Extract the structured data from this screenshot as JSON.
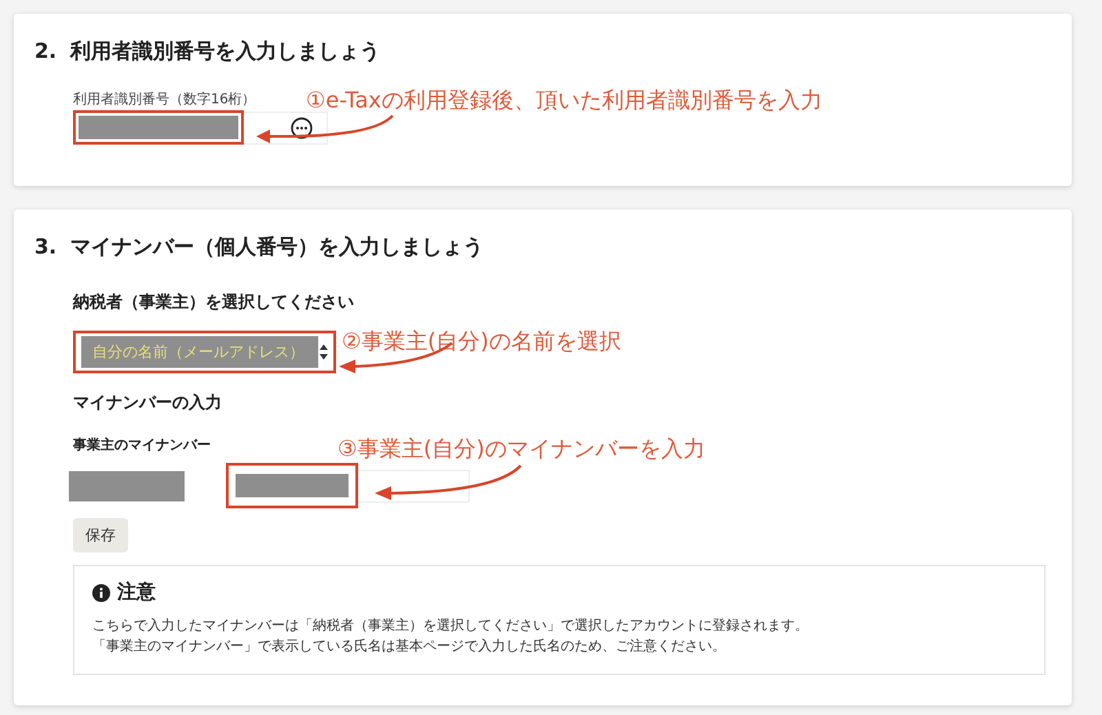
{
  "section_2": {
    "number": "2.",
    "title": "利用者識別番号を入力しましょう",
    "field_label": "利用者識別番号（数字16桁）"
  },
  "section_3": {
    "number": "3.",
    "title": "マイナンバー（個人番号）を入力しましょう",
    "taxpayer_label": "納税者（事業主）を選択してください",
    "taxpayer_select": {
      "value": "自分の名前（メールアドレス）"
    },
    "mynumber_heading": "マイナンバーの入力",
    "mynumber_label": "事業主のマイナンバー",
    "save_button": "保存",
    "notice": {
      "title": "注意",
      "lines": [
        "こちらで入力したマイナンバーは「納税者（事業主）を選択してください」で選択したアカウントに登録されます。",
        "「事業主のマイナンバー」で表示している氏名は基本ページで入力した氏名のため、ご注意ください。"
      ]
    }
  },
  "annotations": [
    "①e-Taxの利用登録後、頂いた利用者識別番号を入力",
    "②事業主(自分)の名前を選択",
    "③事業主(自分)のマイナンバーを入力"
  ]
}
